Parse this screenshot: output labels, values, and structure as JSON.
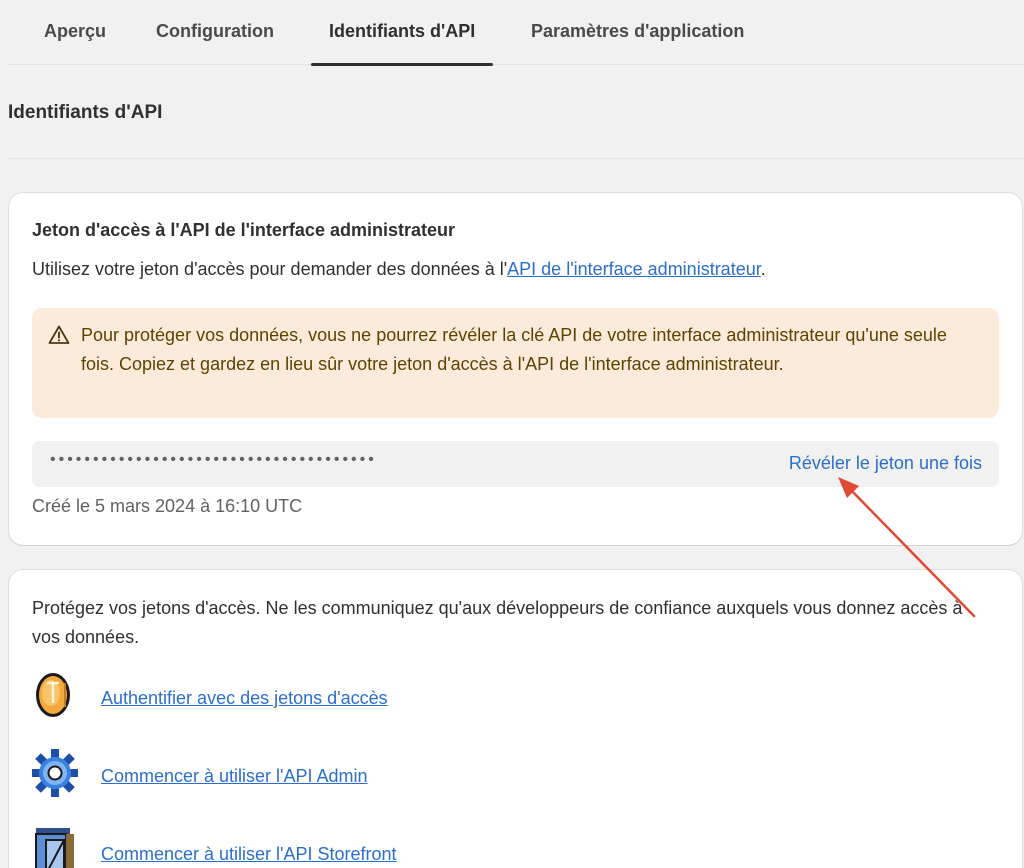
{
  "tabs": [
    {
      "label": "Aperçu"
    },
    {
      "label": "Configuration"
    },
    {
      "label": "Identifiants d'API",
      "active": true
    },
    {
      "label": "Paramètres d'application"
    }
  ],
  "section_title": "Identifiants d'API",
  "admin_token_card": {
    "title": "Jeton d'accès à l'API de l'interface administrateur",
    "desc_prefix": "Utilisez votre jeton d'accès pour demander des données à l'",
    "desc_link": "API de l'interface administrateur",
    "desc_suffix": ".",
    "warning": "Pour protéger vos données, vous ne pourrez révéler la clé API de votre interface administrateur qu'une seule fois. Copiez et gardez en lieu sûr votre jeton d'accès à l'API de l'interface administrateur.",
    "token_mask": "••••••••••••••••••••••••••••••••••••••",
    "reveal_label": "Révéler le jeton une fois",
    "created": "Créé le 5 mars 2024 à 16:10 UTC"
  },
  "security_card": {
    "text": "Protégez vos jetons d'accès. Ne les communiquez qu'aux développeurs de confiance auxquels vous donnez accès à vos données.",
    "resources": [
      {
        "label": "Authentifier avec des jetons d'accès",
        "icon": "coin-icon"
      },
      {
        "label": "Commencer à utiliser l'API Admin",
        "icon": "gear-icon"
      },
      {
        "label": "Commencer à utiliser l'API Storefront",
        "icon": "storefront-icon"
      }
    ]
  },
  "colors": {
    "accent_link": "#2c6ecb",
    "warning_bg": "#fcebdb",
    "annotation_arrow": "#e04a33"
  }
}
